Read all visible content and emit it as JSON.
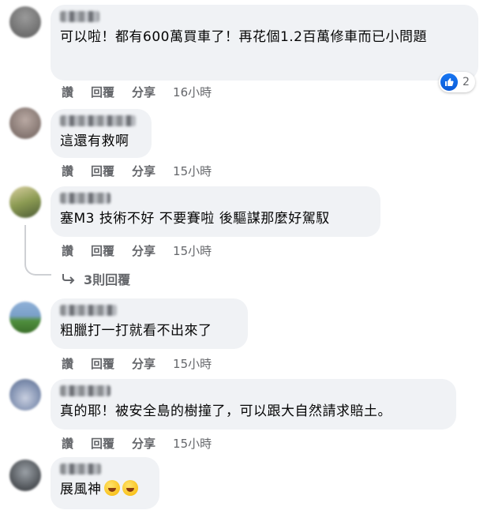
{
  "comments": [
    {
      "text": "可以啦！都有600萬買車了！再花個1.2百萬修車而已小問題",
      "actions": {
        "like": "讚",
        "reply": "回覆",
        "share": "分享",
        "time": "16小時"
      },
      "reaction_count": "2"
    },
    {
      "text": "這還有救啊",
      "actions": {
        "like": "讚",
        "reply": "回覆",
        "share": "分享",
        "time": "15小時"
      }
    },
    {
      "text": "塞M3 技術不好 不要賽啦 後驅謀那麼好駕馭",
      "actions": {
        "like": "讚",
        "reply": "回覆",
        "share": "分享",
        "time": "15小時"
      },
      "replies_label": "3則回覆"
    },
    {
      "text": "粗臘打一打就看不出來了",
      "actions": {
        "like": "讚",
        "reply": "回覆",
        "share": "分享",
        "time": "15小時"
      }
    },
    {
      "text": "真的耶！被安全島的樹撞了，可以跟大自然請求賠土。",
      "actions": {
        "like": "讚",
        "reply": "回覆",
        "share": "分享",
        "time": "15小時"
      }
    },
    {
      "text": "展風神",
      "emoji": [
        "grinning-sweat-emoji",
        "laughing-emoji"
      ]
    }
  ],
  "colors": {
    "bubble": "#f0f2f5",
    "meta": "#65676b",
    "like": "#1877f2"
  }
}
